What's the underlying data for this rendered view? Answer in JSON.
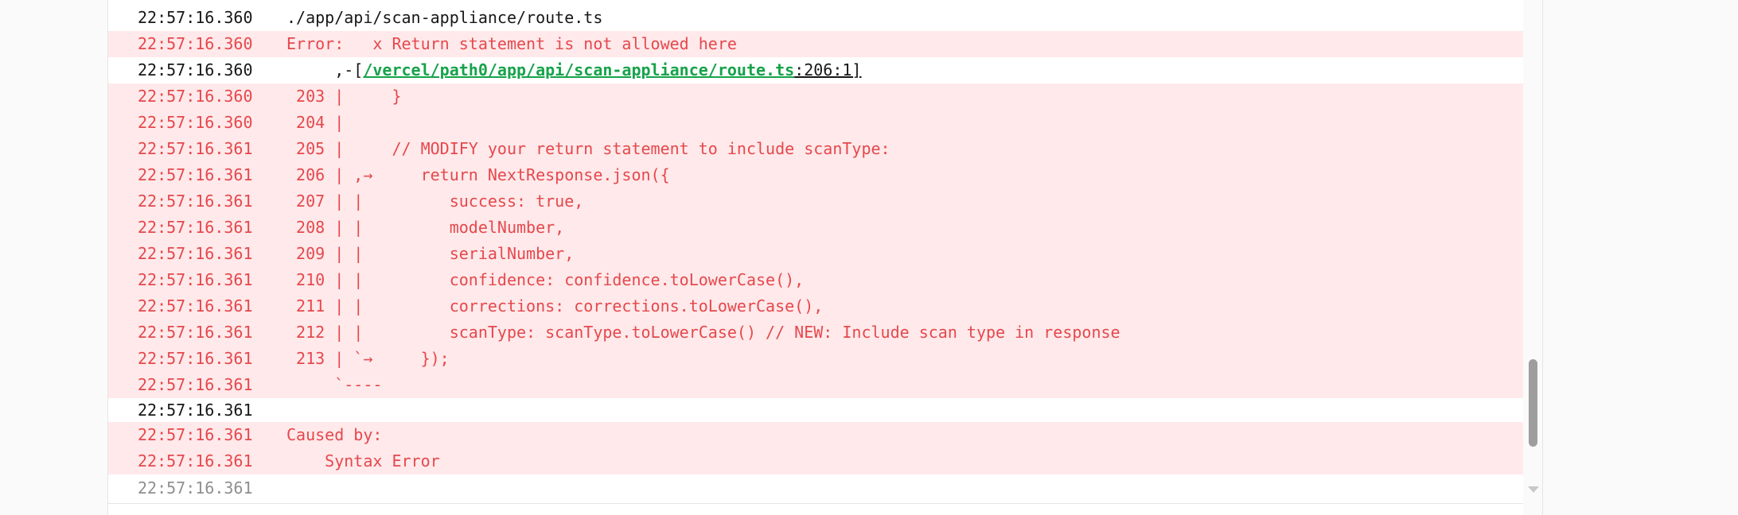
{
  "log": {
    "rows": [
      {
        "ts": "22:57:16.360",
        "text": "./app/api/scan-appliance/route.ts",
        "kind": "normal"
      },
      {
        "ts": "22:57:16.360",
        "text": "Error:   x Return statement is not allowed here",
        "kind": "err"
      },
      {
        "ts": "22:57:16.360",
        "prefix": "     ,-[",
        "link": "/vercel/path0/app/api/scan-appliance/route.ts",
        "suffix": ":206:1]",
        "kind": "normal"
      },
      {
        "ts": "22:57:16.360",
        "text": " 203 |     }",
        "kind": "err"
      },
      {
        "ts": "22:57:16.360",
        "text": " 204 |",
        "kind": "err"
      },
      {
        "ts": "22:57:16.361",
        "text": " 205 |     // MODIFY your return statement to include scanType:",
        "kind": "err"
      },
      {
        "ts": "22:57:16.361",
        "text": " 206 | ,→     return NextResponse.json({",
        "kind": "err"
      },
      {
        "ts": "22:57:16.361",
        "text": " 207 | |         success: true,",
        "kind": "err"
      },
      {
        "ts": "22:57:16.361",
        "text": " 208 | |         modelNumber,",
        "kind": "err"
      },
      {
        "ts": "22:57:16.361",
        "text": " 209 | |         serialNumber,",
        "kind": "err"
      },
      {
        "ts": "22:57:16.361",
        "text": " 210 | |         confidence: confidence.toLowerCase(),",
        "kind": "err"
      },
      {
        "ts": "22:57:16.361",
        "text": " 211 | |         corrections: corrections.toLowerCase(),",
        "kind": "err"
      },
      {
        "ts": "22:57:16.361",
        "text": " 212 | |         scanType: scanType.toLowerCase() // NEW: Include scan type in response",
        "kind": "err"
      },
      {
        "ts": "22:57:16.361",
        "text": " 213 | `→     });",
        "kind": "err"
      },
      {
        "ts": "22:57:16.361",
        "text": "     `----",
        "kind": "err"
      },
      {
        "ts": "22:57:16.361",
        "text": "",
        "kind": "blank"
      },
      {
        "ts": "22:57:16.361",
        "text": "Caused by:",
        "kind": "err"
      },
      {
        "ts": "22:57:16.361",
        "text": "    Syntax Error",
        "kind": "err"
      },
      {
        "ts": "22:57:16.361",
        "text": "",
        "kind": "partial"
      }
    ]
  },
  "colors": {
    "error_bg": "#ffe9ea",
    "error_text": "#e5484d",
    "link": "#16a34a",
    "text": "#171717"
  },
  "icons": {
    "scroll_down": "scroll-down-arrow-icon"
  }
}
